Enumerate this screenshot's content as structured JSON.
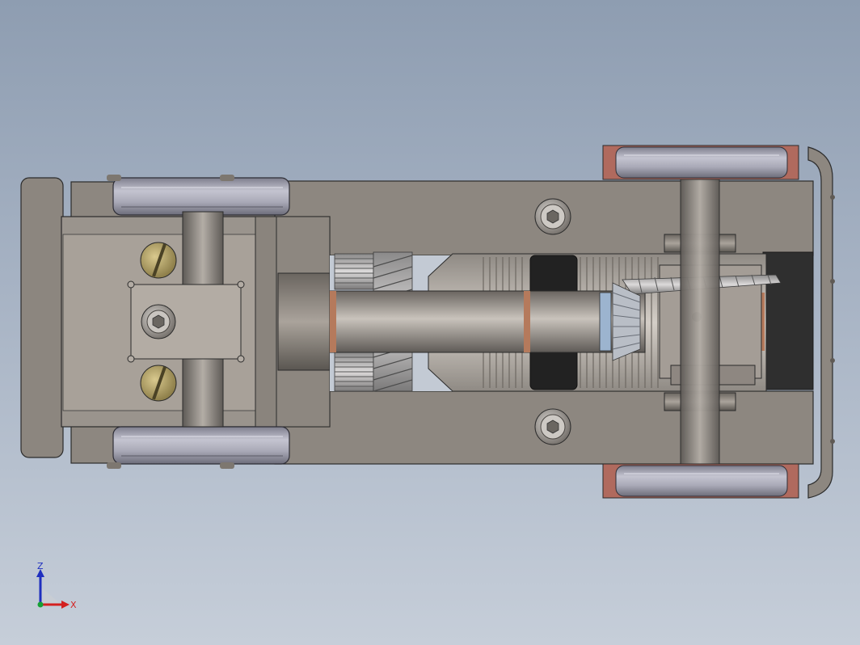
{
  "view": {
    "background_top": "#8e9db1",
    "background_bottom": "#c6ced9"
  },
  "triad": {
    "z_label": "Z",
    "x_label": "X",
    "z_color": "#1f2fbf",
    "x_color": "#d3201f",
    "origin_color": "#16a035"
  },
  "colors": {
    "chassis": "#8a847d",
    "chassis_dark": "#6f6a64",
    "wheel": "#9a9aa8",
    "wheel_rim": "#b06a5e",
    "axle": "#8c8782",
    "brass": "#b5a46a",
    "motor_black": "#232323",
    "copper": "#b57a5c"
  },
  "icons": {
    "hex_socket_screw": "hex-socket-screw-icon",
    "slotted_screw": "slotted-screw-icon"
  }
}
